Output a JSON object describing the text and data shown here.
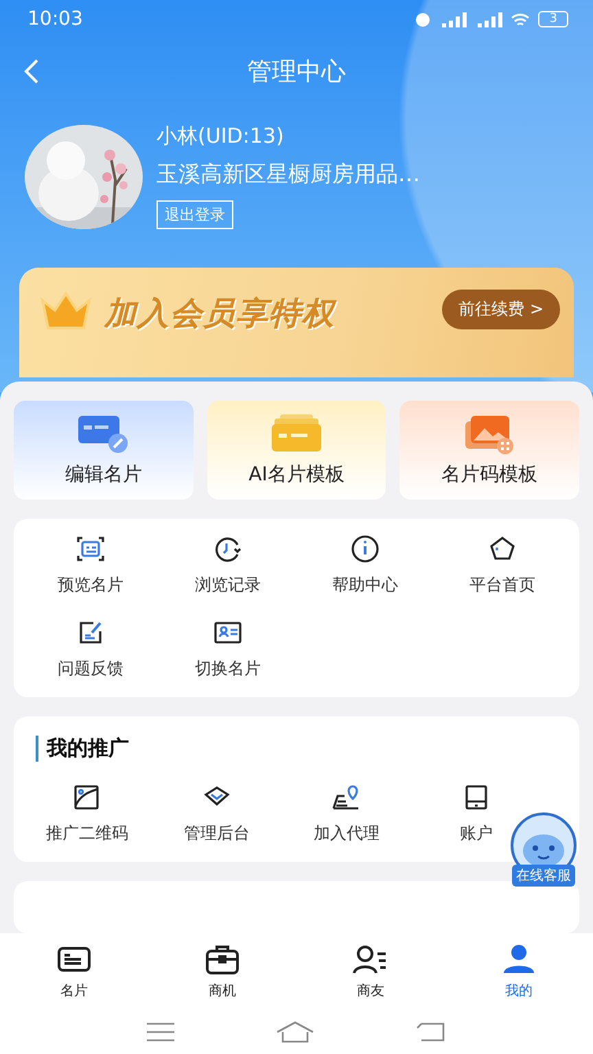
{
  "status_bar": {
    "time": "10:03",
    "battery": "3"
  },
  "header": {
    "title": "管理中心"
  },
  "profile": {
    "name": "小林(UID:13)",
    "company": "玉溪高新区星橱厨房用品…",
    "logout": "退出登录"
  },
  "banner": {
    "title": "加入会员享特权",
    "button": "前往续费 >"
  },
  "feature_cards": [
    {
      "label": "编辑名片",
      "kind": "edit"
    },
    {
      "label": "AI名片模板",
      "kind": "ai"
    },
    {
      "label": "名片码模板",
      "kind": "code"
    }
  ],
  "tools": [
    {
      "label": "预览名片",
      "kind": "preview"
    },
    {
      "label": "浏览记录",
      "kind": "history"
    },
    {
      "label": "帮助中心",
      "kind": "help"
    },
    {
      "label": "平台首页",
      "kind": "home"
    },
    {
      "label": "问题反馈",
      "kind": "feedback"
    },
    {
      "label": "切换名片",
      "kind": "switch"
    }
  ],
  "promotion": {
    "title": "我的推广",
    "items": [
      {
        "label": "推广二维码",
        "kind": "qrcode"
      },
      {
        "label": "管理后台",
        "kind": "admin"
      },
      {
        "label": "加入代理",
        "kind": "agent"
      },
      {
        "label": "账户",
        "kind": "account"
      }
    ]
  },
  "service_button": {
    "label": "在线客服"
  },
  "tabs": [
    {
      "label": "名片",
      "kind": "card",
      "selected": false
    },
    {
      "label": "商机",
      "kind": "briefcase",
      "selected": false
    },
    {
      "label": "商友",
      "kind": "friends",
      "selected": false
    },
    {
      "label": "我的",
      "kind": "me",
      "selected": true
    }
  ]
}
